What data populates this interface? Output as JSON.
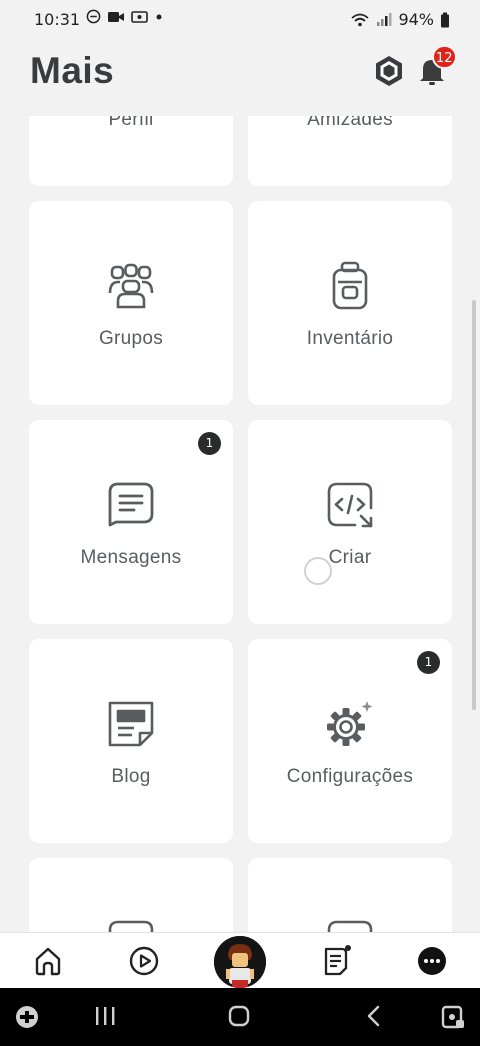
{
  "status_bar": {
    "time": "10:31",
    "battery": "94%"
  },
  "header": {
    "title": "Mais",
    "notification_count": "12"
  },
  "tiles": [
    {
      "label": "Perfil",
      "badge": ""
    },
    {
      "label": "Amizades",
      "badge": ""
    },
    {
      "label": "Grupos",
      "badge": ""
    },
    {
      "label": "Inventário",
      "badge": ""
    },
    {
      "label": "Mensagens",
      "badge": "1"
    },
    {
      "label": "Criar",
      "badge": ""
    },
    {
      "label": "Blog",
      "badge": ""
    },
    {
      "label": "Configurações",
      "badge": "1"
    },
    {
      "label": "",
      "badge": ""
    },
    {
      "label": "",
      "badge": ""
    }
  ],
  "bottom_nav": [
    "home-icon",
    "discover-play-icon",
    "avatar",
    "feed-icon",
    "more-icon"
  ],
  "system_nav": [
    "game-launcher-icon",
    "recents-icon",
    "home-circle-icon",
    "back-icon",
    "screen-capture-icon"
  ]
}
